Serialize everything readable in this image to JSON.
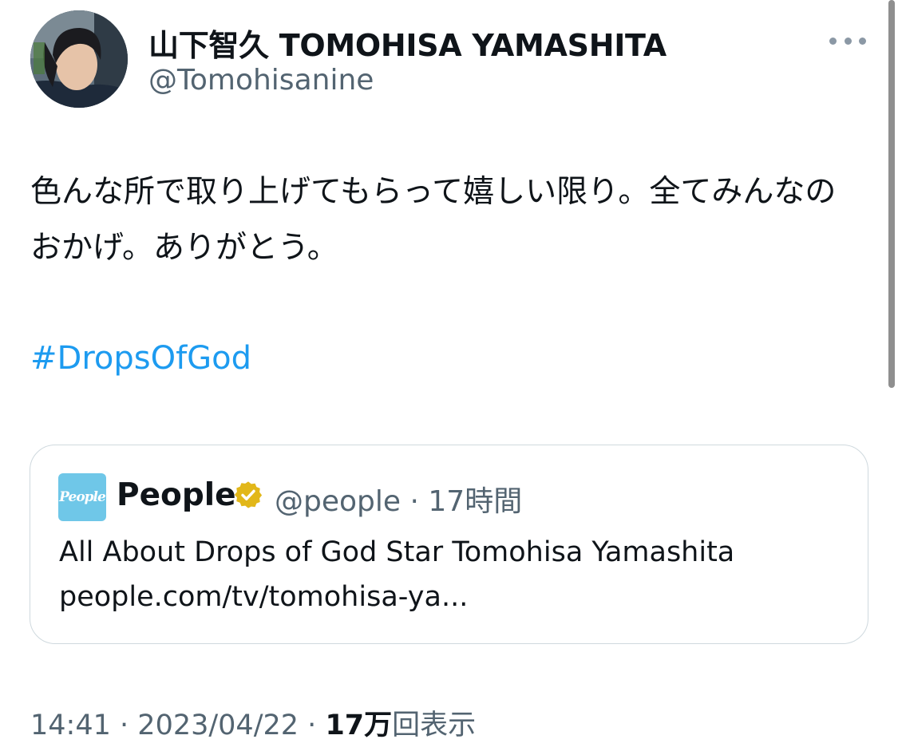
{
  "author": {
    "display_name": "山下智久 TOMOHISA YAMASHITA",
    "handle": "@Tomohisanine",
    "avatar_icon": "profile-photo"
  },
  "more_icon": "ellipsis-icon",
  "tweet": {
    "text": "色んな所で取り上げてもらって嬉しい限り。全てみんなのおかげ。ありがとう。",
    "hashtag": "#DropsOfGod"
  },
  "quote": {
    "logo_text": "People",
    "name": "People",
    "verified_badge": "gold-verified-badge",
    "handle": "@people",
    "separator": "·",
    "time": "17時間",
    "headline": "All About Drops of God Star Tomohisa Yamashita",
    "link": "people.com/tv/tomohisa-ya..."
  },
  "footer": {
    "time": "14:41",
    "sep1": "·",
    "date": "2023/04/22",
    "sep2": "·",
    "views_count": "17万",
    "views_label": "回表示"
  },
  "colors": {
    "link": "#1d9bf0",
    "secondary_text": "#536471",
    "border": "#cfd9de",
    "badge_gold": "#e2b719",
    "people_logo_bg": "#6fc7e8"
  }
}
